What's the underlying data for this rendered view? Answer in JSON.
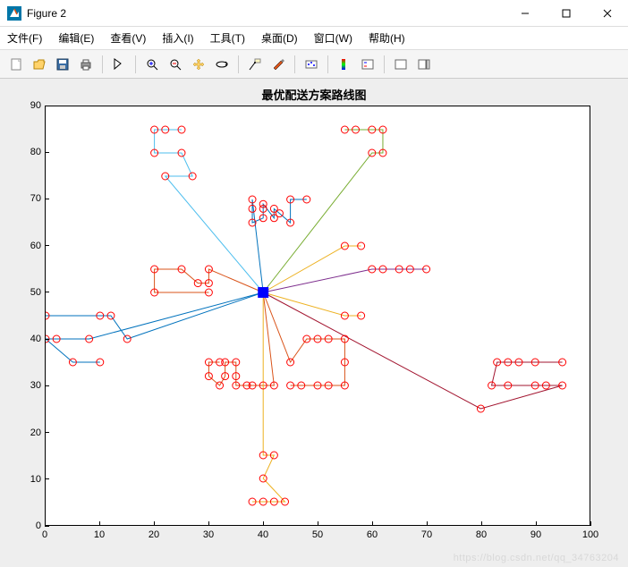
{
  "window": {
    "title": "Figure 2"
  },
  "menu": {
    "file": "文件(F)",
    "edit": "编辑(E)",
    "view": "查看(V)",
    "insert": "插入(I)",
    "tools": "工具(T)",
    "desktop": "桌面(D)",
    "window": "窗口(W)",
    "help": "帮助(H)"
  },
  "chart_data": {
    "type": "scatter",
    "title": "最优配送方案路线图",
    "xlabel": "",
    "ylabel": "",
    "xlim": [
      0,
      100
    ],
    "ylim": [
      0,
      90
    ],
    "xticks": [
      0,
      10,
      20,
      30,
      40,
      50,
      60,
      70,
      80,
      90,
      100
    ],
    "yticks": [
      0,
      10,
      20,
      30,
      40,
      50,
      60,
      70,
      80,
      90
    ],
    "depot": {
      "x": 40,
      "y": 50
    },
    "customers": [
      [
        0,
        40
      ],
      [
        0,
        45
      ],
      [
        2,
        40
      ],
      [
        5,
        35
      ],
      [
        8,
        40
      ],
      [
        10,
        35
      ],
      [
        10,
        45
      ],
      [
        12,
        45
      ],
      [
        15,
        40
      ],
      [
        20,
        50
      ],
      [
        20,
        55
      ],
      [
        22,
        75
      ],
      [
        25,
        55
      ],
      [
        25,
        85
      ],
      [
        27,
        75
      ],
      [
        20,
        80
      ],
      [
        20,
        85
      ],
      [
        25,
        80
      ],
      [
        30,
        50
      ],
      [
        30,
        52
      ],
      [
        30,
        55
      ],
      [
        28,
        52
      ],
      [
        22,
        85
      ],
      [
        30,
        32
      ],
      [
        30,
        35
      ],
      [
        32,
        30
      ],
      [
        32,
        35
      ],
      [
        33,
        32
      ],
      [
        33,
        35
      ],
      [
        35,
        30
      ],
      [
        35,
        32
      ],
      [
        35,
        35
      ],
      [
        37,
        30
      ],
      [
        38,
        30
      ],
      [
        40,
        30
      ],
      [
        42,
        30
      ],
      [
        38,
        5
      ],
      [
        40,
        5
      ],
      [
        40,
        10
      ],
      [
        40,
        15
      ],
      [
        42,
        5
      ],
      [
        42,
        15
      ],
      [
        44,
        5
      ],
      [
        45,
        30
      ],
      [
        45,
        35
      ],
      [
        47,
        30
      ],
      [
        48,
        40
      ],
      [
        50,
        30
      ],
      [
        50,
        40
      ],
      [
        52,
        30
      ],
      [
        55,
        30
      ],
      [
        55,
        35
      ],
      [
        55,
        40
      ],
      [
        52,
        40
      ],
      [
        38,
        65
      ],
      [
        38,
        68
      ],
      [
        40,
        66
      ],
      [
        40,
        68
      ],
      [
        40,
        69
      ],
      [
        42,
        66
      ],
      [
        42,
        68
      ],
      [
        43,
        67
      ],
      [
        45,
        65
      ],
      [
        45,
        70
      ],
      [
        48,
        70
      ],
      [
        38,
        70
      ],
      [
        55,
        45
      ],
      [
        58,
        45
      ],
      [
        55,
        60
      ],
      [
        60,
        55
      ],
      [
        62,
        55
      ],
      [
        65,
        55
      ],
      [
        67,
        55
      ],
      [
        70,
        55
      ],
      [
        58,
        60
      ],
      [
        55,
        85
      ],
      [
        57,
        85
      ],
      [
        60,
        85
      ],
      [
        62,
        85
      ],
      [
        60,
        80
      ],
      [
        62,
        80
      ],
      [
        83,
        35
      ],
      [
        85,
        35
      ],
      [
        87,
        35
      ],
      [
        90,
        35
      ],
      [
        95,
        35
      ],
      [
        82,
        30
      ],
      [
        85,
        30
      ],
      [
        90,
        30
      ],
      [
        92,
        30
      ],
      [
        95,
        30
      ],
      [
        80,
        25
      ]
    ],
    "routes": [
      {
        "color": "#0072BD",
        "points": [
          [
            40,
            50
          ],
          [
            15,
            40
          ],
          [
            12,
            45
          ],
          [
            10,
            45
          ],
          [
            0,
            45
          ]
        ]
      },
      {
        "color": "#0072BD",
        "points": [
          [
            40,
            50
          ],
          [
            8,
            40
          ],
          [
            2,
            40
          ],
          [
            0,
            40
          ],
          [
            5,
            35
          ],
          [
            10,
            35
          ]
        ]
      },
      {
        "color": "#D95319",
        "points": [
          [
            40,
            50
          ],
          [
            30,
            55
          ],
          [
            30,
            52
          ],
          [
            28,
            52
          ],
          [
            25,
            55
          ],
          [
            20,
            55
          ],
          [
            20,
            50
          ],
          [
            30,
            50
          ]
        ]
      },
      {
        "color": "#4DBEEE",
        "points": [
          [
            40,
            50
          ],
          [
            22,
            75
          ],
          [
            27,
            75
          ],
          [
            25,
            80
          ],
          [
            20,
            80
          ],
          [
            20,
            85
          ],
          [
            22,
            85
          ],
          [
            25,
            85
          ]
        ]
      },
      {
        "color": "#0072BD",
        "points": [
          [
            40,
            50
          ],
          [
            38,
            70
          ],
          [
            38,
            68
          ],
          [
            38,
            65
          ],
          [
            40,
            66
          ],
          [
            40,
            68
          ],
          [
            40,
            69
          ],
          [
            42,
            66
          ],
          [
            42,
            68
          ],
          [
            43,
            67
          ],
          [
            45,
            65
          ],
          [
            45,
            70
          ],
          [
            48,
            70
          ]
        ]
      },
      {
        "color": "#77AC30",
        "points": [
          [
            40,
            50
          ],
          [
            60,
            80
          ],
          [
            62,
            80
          ],
          [
            62,
            85
          ],
          [
            60,
            85
          ],
          [
            57,
            85
          ],
          [
            55,
            85
          ]
        ]
      },
      {
        "color": "#EDB120",
        "points": [
          [
            40,
            50
          ],
          [
            55,
            45
          ],
          [
            58,
            45
          ]
        ]
      },
      {
        "color": "#EDB120",
        "points": [
          [
            40,
            50
          ],
          [
            55,
            60
          ],
          [
            58,
            60
          ]
        ]
      },
      {
        "color": "#7E2F8E",
        "points": [
          [
            40,
            50
          ],
          [
            60,
            55
          ],
          [
            62,
            55
          ],
          [
            65,
            55
          ],
          [
            67,
            55
          ],
          [
            70,
            55
          ]
        ]
      },
      {
        "color": "#A2142F",
        "points": [
          [
            40,
            50
          ],
          [
            80,
            25
          ],
          [
            95,
            30
          ],
          [
            92,
            30
          ],
          [
            90,
            30
          ],
          [
            85,
            30
          ],
          [
            82,
            30
          ],
          [
            83,
            35
          ],
          [
            85,
            35
          ],
          [
            87,
            35
          ],
          [
            90,
            35
          ],
          [
            95,
            35
          ]
        ]
      },
      {
        "color": "#D95319",
        "points": [
          [
            40,
            50
          ],
          [
            45,
            35
          ],
          [
            48,
            40
          ],
          [
            50,
            40
          ],
          [
            52,
            40
          ],
          [
            55,
            40
          ],
          [
            55,
            35
          ],
          [
            55,
            30
          ],
          [
            52,
            30
          ],
          [
            50,
            30
          ],
          [
            47,
            30
          ],
          [
            45,
            30
          ]
        ]
      },
      {
        "color": "#D95319",
        "points": [
          [
            40,
            50
          ],
          [
            42,
            30
          ],
          [
            40,
            30
          ],
          [
            38,
            30
          ],
          [
            37,
            30
          ],
          [
            35,
            30
          ],
          [
            35,
            32
          ],
          [
            35,
            35
          ],
          [
            33,
            35
          ],
          [
            33,
            32
          ],
          [
            32,
            30
          ],
          [
            30,
            32
          ],
          [
            30,
            35
          ],
          [
            32,
            35
          ]
        ]
      },
      {
        "color": "#EDB120",
        "points": [
          [
            40,
            50
          ],
          [
            40,
            15
          ],
          [
            42,
            15
          ],
          [
            40,
            10
          ],
          [
            44,
            5
          ],
          [
            42,
            5
          ],
          [
            40,
            5
          ],
          [
            38,
            5
          ]
        ]
      }
    ]
  },
  "watermark": "https://blog.csdn.net/qq_34763204"
}
